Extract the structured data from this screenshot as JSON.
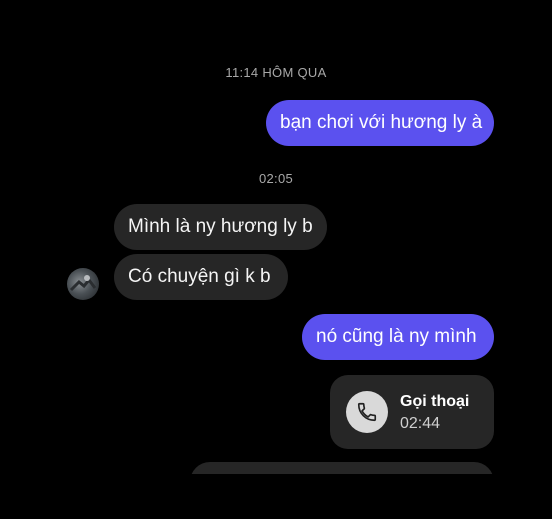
{
  "conversation": {
    "timestamps": [
      "11:14 HÔM QUA",
      "02:05"
    ],
    "messages": [
      {
        "from": "me",
        "text": "bạn chơi với hương ly à"
      },
      {
        "from": "them",
        "text": "Mình là ny hương ly b"
      },
      {
        "from": "them",
        "text": "Có chuyện gì k b"
      },
      {
        "from": "me",
        "text": "nó cũng là ny mình"
      }
    ],
    "call": {
      "title": "Gọi thoại",
      "duration": "02:44",
      "icon": "phone-icon"
    }
  },
  "colors": {
    "background": "#000000",
    "outgoing_bubble": "#5b51ef",
    "incoming_bubble": "#262626",
    "timestamp_text": "#a8a8a8"
  }
}
